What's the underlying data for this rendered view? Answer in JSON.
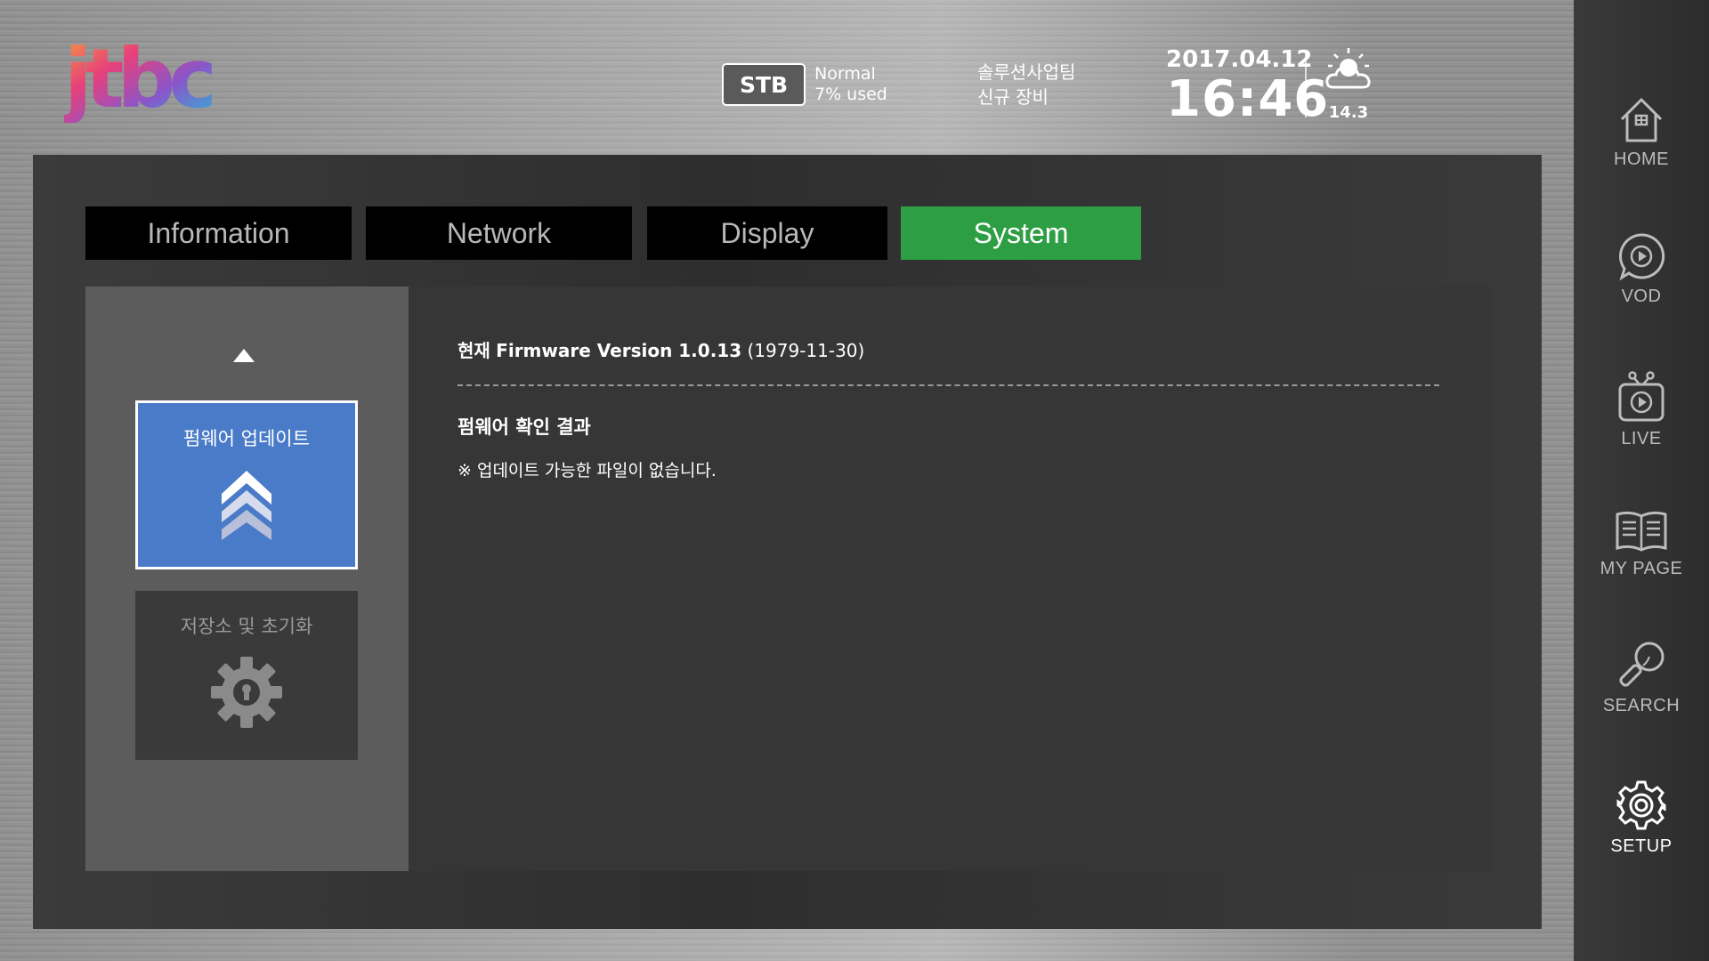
{
  "header": {
    "logo_text": "jtbc",
    "stb": {
      "badge": "STB",
      "status_line1": "Normal",
      "status_line2": "7% used"
    },
    "org": {
      "line1": "솔루션사업팀",
      "line2": "신규 장비"
    },
    "date": "2017.04.12",
    "time": "16:46",
    "weather": {
      "icon": "partly-cloudy-icon",
      "temperature": "14.3"
    }
  },
  "tabs": [
    {
      "label": "Information",
      "active": false
    },
    {
      "label": "Network",
      "active": false
    },
    {
      "label": "Display",
      "active": false
    },
    {
      "label": "System",
      "active": true
    }
  ],
  "menu": {
    "items": [
      {
        "label": "펌웨어 업데이트",
        "icon": "chevrons-up-icon",
        "selected": true
      },
      {
        "label": "저장소 및 초기화",
        "icon": "gear-lock-icon",
        "selected": false
      }
    ]
  },
  "content": {
    "firmware_prefix": "현재",
    "firmware_label": "Firmware Version 1.0.13",
    "firmware_date": "(1979-11-30)",
    "result_title": "펌웨어 확인 결과",
    "result_message": "※ 업데이트 가능한 파일이 없습니다."
  },
  "sidebar": {
    "items": [
      {
        "label": "HOME",
        "icon": "home-icon"
      },
      {
        "label": "VOD",
        "icon": "play-bubble-icon"
      },
      {
        "label": "LIVE",
        "icon": "tv-play-icon"
      },
      {
        "label": "MY PAGE",
        "icon": "book-icon"
      },
      {
        "label": "SEARCH",
        "icon": "search-icon"
      },
      {
        "label": "SETUP",
        "icon": "gear-icon",
        "active": true
      }
    ]
  },
  "colors": {
    "active_tab": "#2e9e44",
    "selected_card": "#4a7bc8",
    "panel": "#363636"
  }
}
